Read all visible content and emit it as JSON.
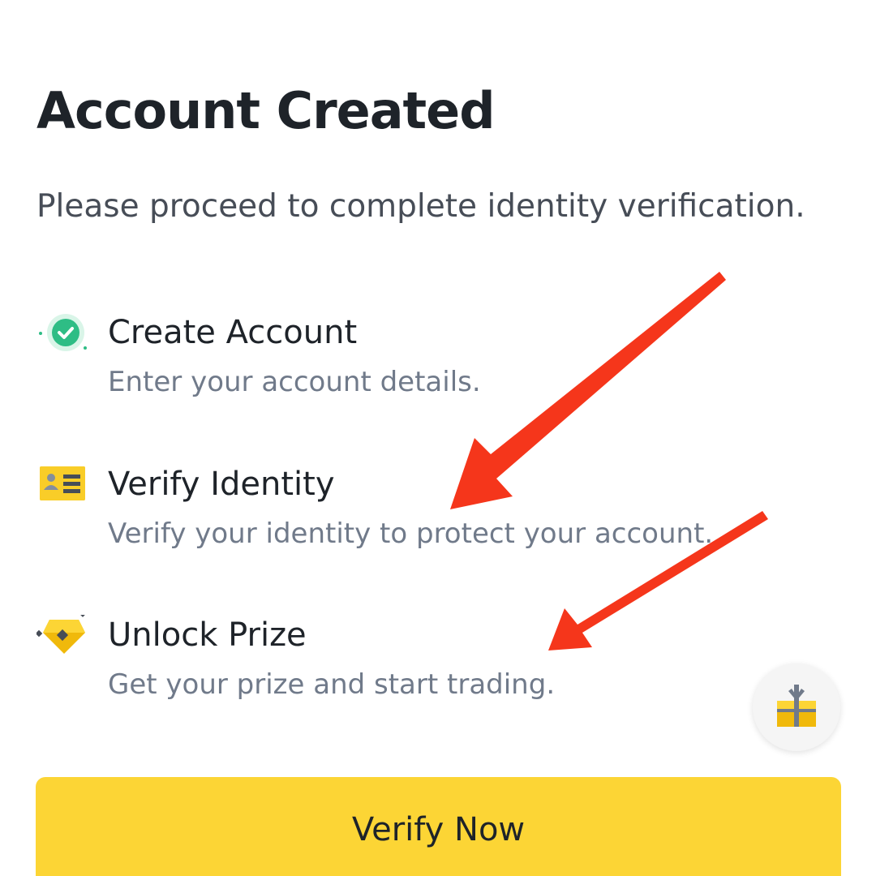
{
  "header": {
    "title": "Account Created",
    "subtitle": "Please proceed to complete identity verification."
  },
  "steps": [
    {
      "title": "Create Account",
      "description": "Enter your account details.",
      "icon": "check-circle-icon",
      "status": "completed"
    },
    {
      "title": "Verify Identity",
      "description": "Verify your identity to protect your account.",
      "icon": "id-card-icon"
    },
    {
      "title": "Unlock Prize",
      "description": "Get your prize and start trading.",
      "icon": "diamond-prize-icon"
    }
  ],
  "floating_button": {
    "icon": "gift-icon"
  },
  "primary_action": {
    "label": "Verify Now"
  },
  "colors": {
    "accent": "#fcd535",
    "success": "#2ebd85",
    "annotation_arrow": "#f5361b",
    "text_primary": "#1e2329",
    "text_secondary": "#707a8a"
  }
}
